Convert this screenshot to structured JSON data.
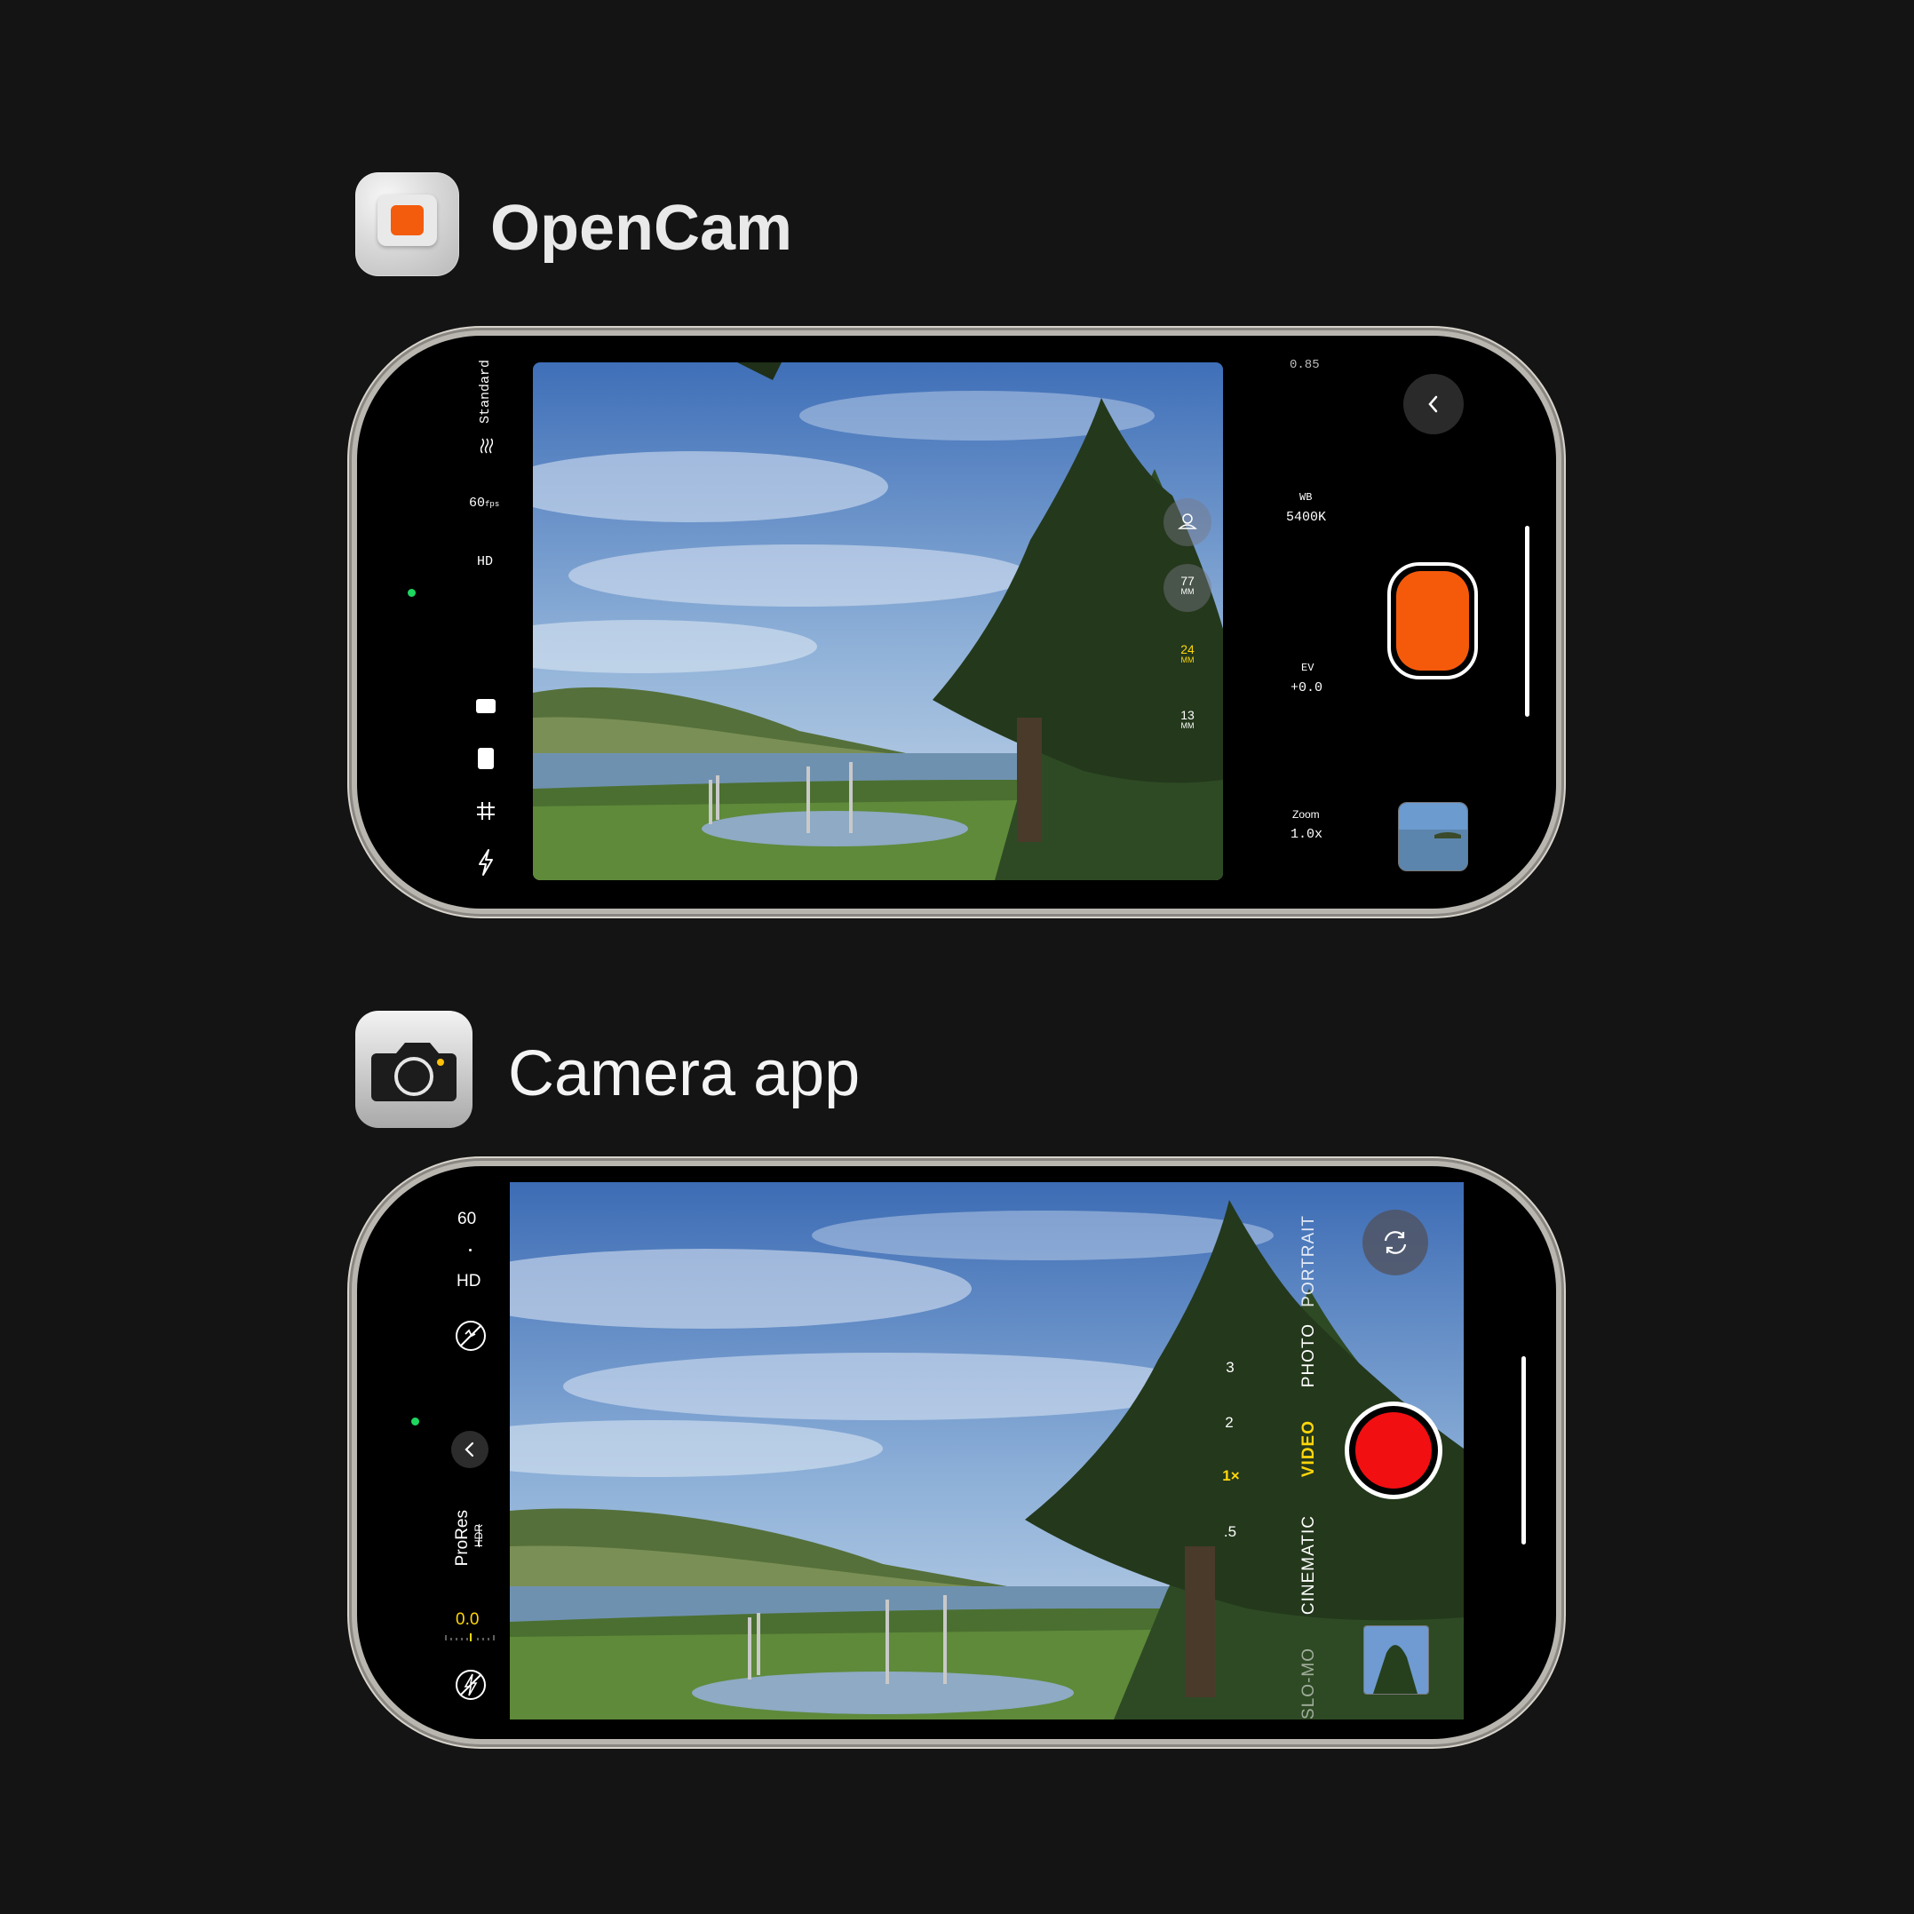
{
  "opencam": {
    "title": "OpenCam",
    "profile": "Standard",
    "fps": "60",
    "fps_unit": "fps",
    "resolution": "HD",
    "aperture": "0.85",
    "wb_label": "WB",
    "wb_value": "5400K",
    "ev_label": "EV",
    "ev_value": "+0.0",
    "zoom_label": "Zoom",
    "zoom_value": "1.0x",
    "lenses": [
      {
        "value": "77",
        "unit": "MM",
        "active": false
      },
      {
        "value": "24",
        "unit": "MM",
        "active": true
      },
      {
        "value": "13",
        "unit": "MM",
        "active": false
      }
    ],
    "colors": {
      "shutter": "#f55a0b",
      "active_lens": "#ffd60a",
      "indicator": "#1ed760"
    },
    "icons": [
      "portrait-icon",
      "aspect-landscape-icon",
      "aspect-portrait-icon",
      "grid-icon",
      "flash-icon",
      "back-chevron-icon",
      "stabilization-icon"
    ]
  },
  "camera_app": {
    "title": "Camera app",
    "fps": "60",
    "resolution": "HD",
    "format": "ProRes",
    "hdr": "HDR",
    "exposure": "0.0",
    "zoom_levels": [
      {
        "label": "3",
        "active": false
      },
      {
        "label": "2",
        "active": false
      },
      {
        "label": "1×",
        "active": true
      },
      {
        "label": ".5",
        "active": false
      }
    ],
    "modes": [
      {
        "label": "PORTRAIT",
        "active": false
      },
      {
        "label": "PHOTO",
        "active": false
      },
      {
        "label": "VIDEO",
        "active": true
      },
      {
        "label": "CINEMATIC",
        "active": false
      },
      {
        "label": "SLO-MO",
        "active": false
      }
    ],
    "colors": {
      "shutter": "#f10f12",
      "active": "#ffd60a",
      "indicator": "#1ed760"
    },
    "icons": [
      "action-mode-off-icon",
      "collapse-chevron-icon",
      "flash-off-icon",
      "camera-flip-icon"
    ]
  }
}
